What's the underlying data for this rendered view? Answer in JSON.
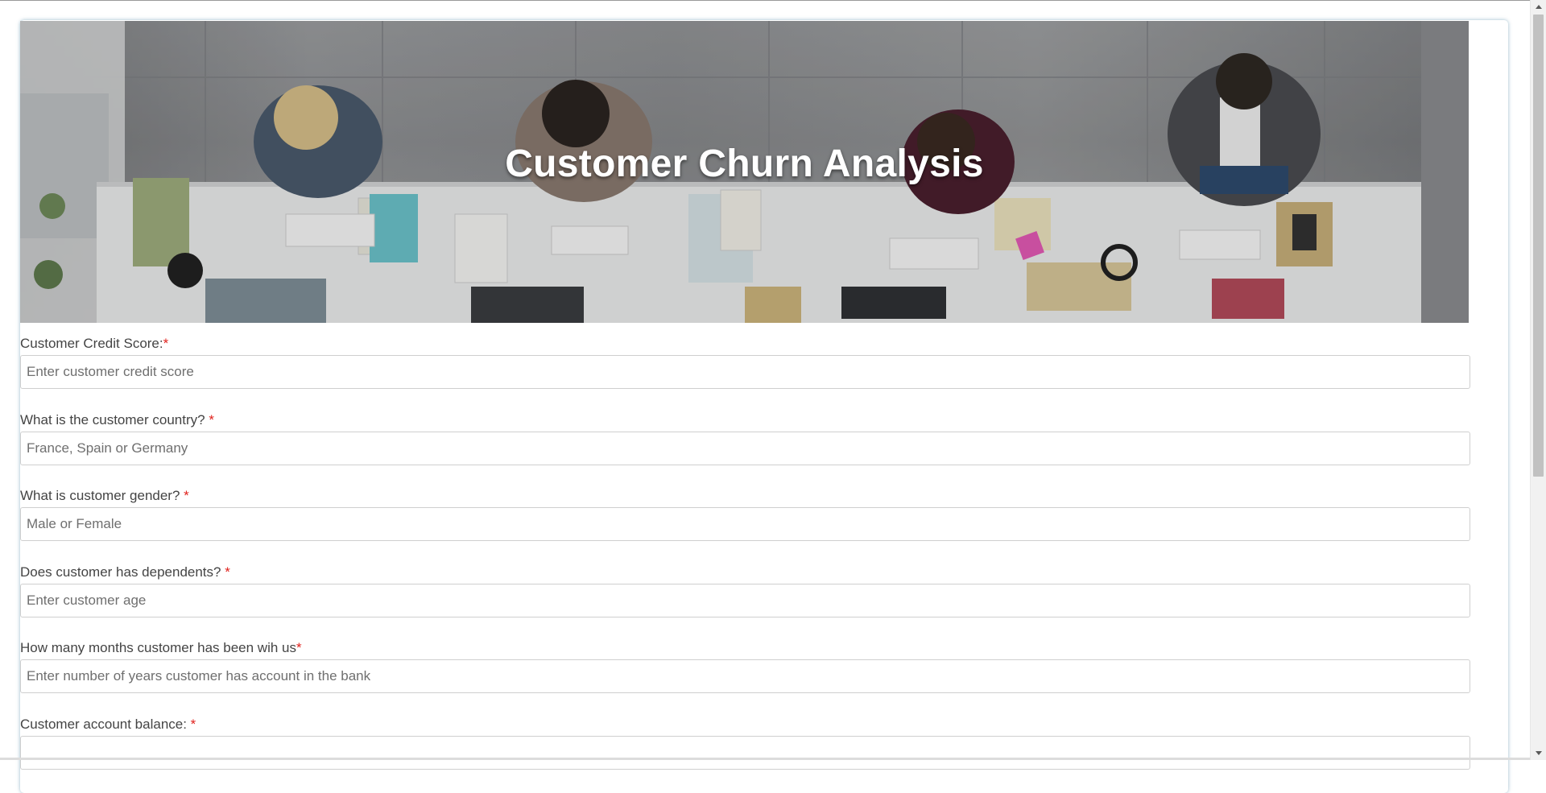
{
  "hero": {
    "title": "Customer Churn Analysis"
  },
  "form": {
    "fields": [
      {
        "label": "Customer Credit Score:",
        "required_mark": "*",
        "placeholder": "Enter customer credit score"
      },
      {
        "label": "What is the customer country? ",
        "required_mark": "*",
        "placeholder": "France, Spain or Germany"
      },
      {
        "label": "What is customer gender? ",
        "required_mark": "*",
        "placeholder": "Male or Female"
      },
      {
        "label": "Does customer has dependents? ",
        "required_mark": "*",
        "placeholder": "Enter customer age"
      },
      {
        "label": "How many months customer has been wih us",
        "required_mark": "*",
        "placeholder": "Enter number of years customer has account in the bank"
      },
      {
        "label": "Customer account balance: ",
        "required_mark": "*",
        "placeholder": ""
      }
    ]
  },
  "colors": {
    "required": "#e0211c",
    "label_text": "#444444",
    "border": "#cfcfcf",
    "card_shadow": "#4682a0"
  }
}
